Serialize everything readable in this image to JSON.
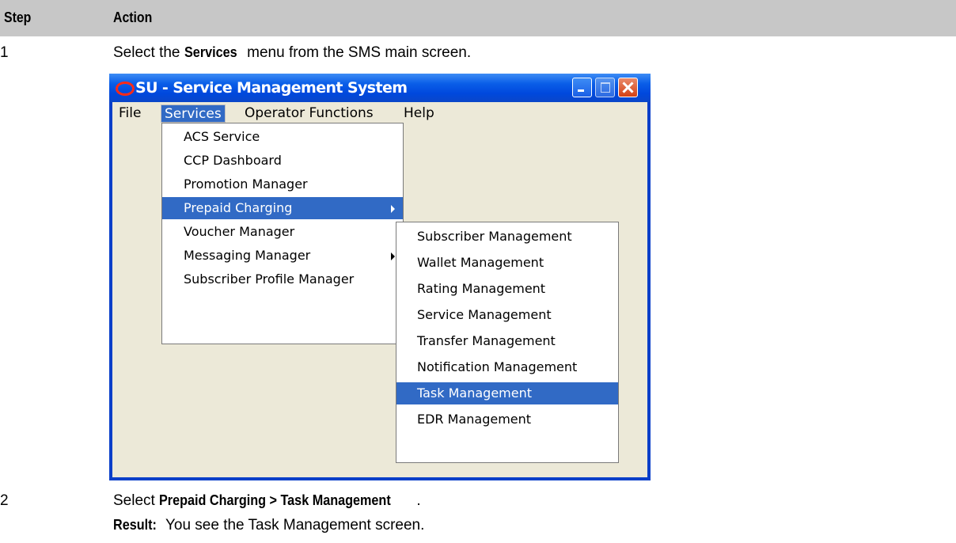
{
  "table": {
    "col_step": "Step",
    "col_action": "Action",
    "rows": [
      {
        "step": "1",
        "pre": "Select the ",
        "bold": "Services",
        "post": " menu from the SMS main screen."
      },
      {
        "step": "2",
        "pre": "Select ",
        "bold": "Prepaid Charging > Task Management",
        "post": "."
      }
    ],
    "result_label": "Result:",
    "result_text": " You see the Task Management screen."
  },
  "window": {
    "title": "SU - Service Management System",
    "menus": [
      "File",
      "Services",
      "Operator Functions",
      "Help"
    ],
    "services_items": [
      {
        "label": "ACS Service",
        "submenu": false
      },
      {
        "label": "CCP Dashboard",
        "submenu": false
      },
      {
        "label": "Promotion Manager",
        "submenu": false
      },
      {
        "label": "Prepaid Charging",
        "submenu": true,
        "selected": true
      },
      {
        "label": "Voucher Manager",
        "submenu": false
      },
      {
        "label": "Messaging Manager",
        "submenu": true
      },
      {
        "label": "Subscriber Profile Manager",
        "submenu": false
      }
    ],
    "prepaid_items": [
      {
        "label": "Subscriber Management"
      },
      {
        "label": "Wallet Management"
      },
      {
        "label": "Rating Management"
      },
      {
        "label": "Service Management"
      },
      {
        "label": "Transfer Management"
      },
      {
        "label": "Notification Management"
      },
      {
        "label": "Task Management",
        "selected": true
      },
      {
        "label": "EDR Management"
      }
    ],
    "accent_color": "#316ac5"
  }
}
